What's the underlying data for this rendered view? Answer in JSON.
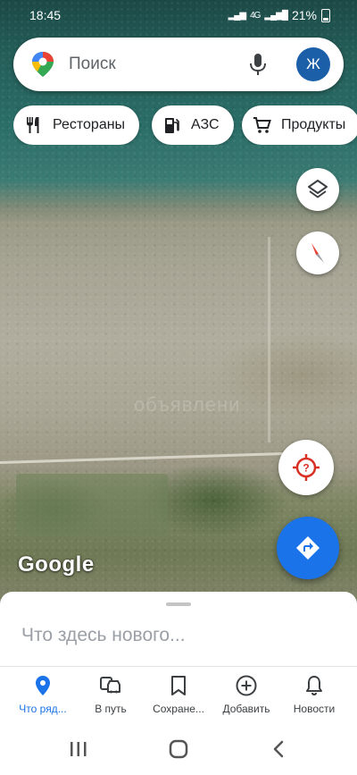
{
  "status": {
    "time": "18:45",
    "signal": "4G",
    "battery": "21%"
  },
  "search": {
    "placeholder": "Поиск",
    "avatar_letter": "Ж"
  },
  "chips": [
    {
      "label": "Рестораны",
      "icon": "restaurant-icon"
    },
    {
      "label": "АЗС",
      "icon": "gas-station-icon"
    },
    {
      "label": "Продукты",
      "icon": "shopping-cart-icon"
    }
  ],
  "map": {
    "attribution": "Google",
    "watermark": "объявлени"
  },
  "sheet": {
    "title": "Что здесь нового..."
  },
  "nav": [
    {
      "label": "Что ряд...",
      "icon": "explore-pin-icon",
      "active": true
    },
    {
      "label": "В путь",
      "icon": "commute-car-icon"
    },
    {
      "label": "Сохране...",
      "icon": "bookmark-icon"
    },
    {
      "label": "Добавить",
      "icon": "add-circle-icon"
    },
    {
      "label": "Новости",
      "icon": "bell-icon"
    }
  ],
  "colors": {
    "accent": "#1a73e8",
    "avatar": "#1a5fa8"
  }
}
